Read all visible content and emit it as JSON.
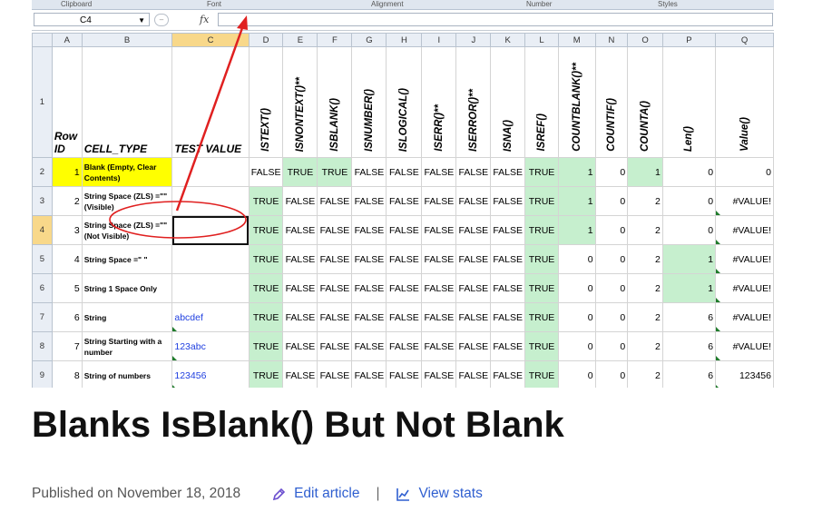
{
  "ribbon": {
    "groups": [
      "Clipboard",
      "Font",
      "Alignment",
      "Number",
      "Styles"
    ]
  },
  "formula_bar": {
    "name_box": "C4",
    "fx": "fx"
  },
  "columns": [
    "A",
    "B",
    "C",
    "D",
    "E",
    "F",
    "G",
    "H",
    "I",
    "J",
    "K",
    "L",
    "M",
    "N",
    "O",
    "P",
    "Q"
  ],
  "headers": {
    "row_id": "Row ID",
    "cell_type": "CELL_TYPE",
    "test_value": "TEST VALUE",
    "functions": [
      "ISTEXT()",
      "ISNONTEXT()**",
      "ISBLANK()",
      "ISNUMBER()",
      "ISLOGICAL()",
      "ISERR()**",
      "ISERROR()**",
      "ISNA()",
      "ISREF()",
      "COUNTBLANK()**",
      "COUNTIF()",
      "COUNTA()",
      "Len()",
      "Value()"
    ]
  },
  "rows": [
    {
      "row": "2",
      "id": "1",
      "type": "Blank (Empty, Clear Contents)",
      "test": "",
      "results": [
        "FALSE",
        "TRUE",
        "TRUE",
        "FALSE",
        "FALSE",
        "FALSE",
        "FALSE",
        "FALSE",
        "TRUE"
      ],
      "countblank": "1",
      "countif": "0",
      "counta": "1",
      "len": "0",
      "value": "0"
    },
    {
      "row": "3",
      "id": "2",
      "type": "String Space (ZLS) =\"\" (Visible)",
      "test": "",
      "results": [
        "TRUE",
        "FALSE",
        "FALSE",
        "FALSE",
        "FALSE",
        "FALSE",
        "FALSE",
        "FALSE",
        "TRUE"
      ],
      "countblank": "1",
      "countif": "0",
      "counta": "2",
      "len": "0",
      "value": "#VALUE!"
    },
    {
      "row": "4",
      "id": "3",
      "type": "String Space (ZLS) =\"\" (Not Visible)",
      "test": "",
      "results": [
        "TRUE",
        "FALSE",
        "FALSE",
        "FALSE",
        "FALSE",
        "FALSE",
        "FALSE",
        "FALSE",
        "TRUE"
      ],
      "countblank": "1",
      "countif": "0",
      "counta": "2",
      "len": "0",
      "value": "#VALUE!"
    },
    {
      "row": "5",
      "id": "4",
      "type": "String Space =\" \"",
      "test": "",
      "results": [
        "TRUE",
        "FALSE",
        "FALSE",
        "FALSE",
        "FALSE",
        "FALSE",
        "FALSE",
        "FALSE",
        "TRUE"
      ],
      "countblank": "0",
      "countif": "0",
      "counta": "2",
      "len": "1",
      "value": "#VALUE!"
    },
    {
      "row": "6",
      "id": "5",
      "type": "String 1 Space Only",
      "test": "",
      "results": [
        "TRUE",
        "FALSE",
        "FALSE",
        "FALSE",
        "FALSE",
        "FALSE",
        "FALSE",
        "FALSE",
        "TRUE"
      ],
      "countblank": "0",
      "countif": "0",
      "counta": "2",
      "len": "1",
      "value": "#VALUE!"
    },
    {
      "row": "7",
      "id": "6",
      "type": "String",
      "test": "abcdef",
      "results": [
        "TRUE",
        "FALSE",
        "FALSE",
        "FALSE",
        "FALSE",
        "FALSE",
        "FALSE",
        "FALSE",
        "TRUE"
      ],
      "countblank": "0",
      "countif": "0",
      "counta": "2",
      "len": "6",
      "value": "#VALUE!"
    },
    {
      "row": "8",
      "id": "7",
      "type": "String Starting with a number",
      "test": "123abc",
      "results": [
        "TRUE",
        "FALSE",
        "FALSE",
        "FALSE",
        "FALSE",
        "FALSE",
        "FALSE",
        "FALSE",
        "TRUE"
      ],
      "countblank": "0",
      "countif": "0",
      "counta": "2",
      "len": "6",
      "value": "#VALUE!"
    },
    {
      "row": "9",
      "id": "8",
      "type": "String of numbers",
      "test": "123456",
      "results": [
        "TRUE",
        "FALSE",
        "FALSE",
        "FALSE",
        "FALSE",
        "FALSE",
        "FALSE",
        "FALSE",
        "TRUE"
      ],
      "countblank": "0",
      "countif": "0",
      "counta": "2",
      "len": "6",
      "value": "123456"
    }
  ],
  "colors": {
    "true_fill": "#c6efce",
    "yellow": "#ffff00",
    "annotation": "#e02020",
    "link": "#2f5fd0"
  },
  "article": {
    "title": "Blanks IsBlank() But Not Blank",
    "published": "Published on November 18, 2018",
    "edit_label": "Edit article",
    "separator": "|",
    "stats_label": "View stats",
    "edit_icon": "pencil-icon",
    "stats_icon": "chart-icon"
  }
}
